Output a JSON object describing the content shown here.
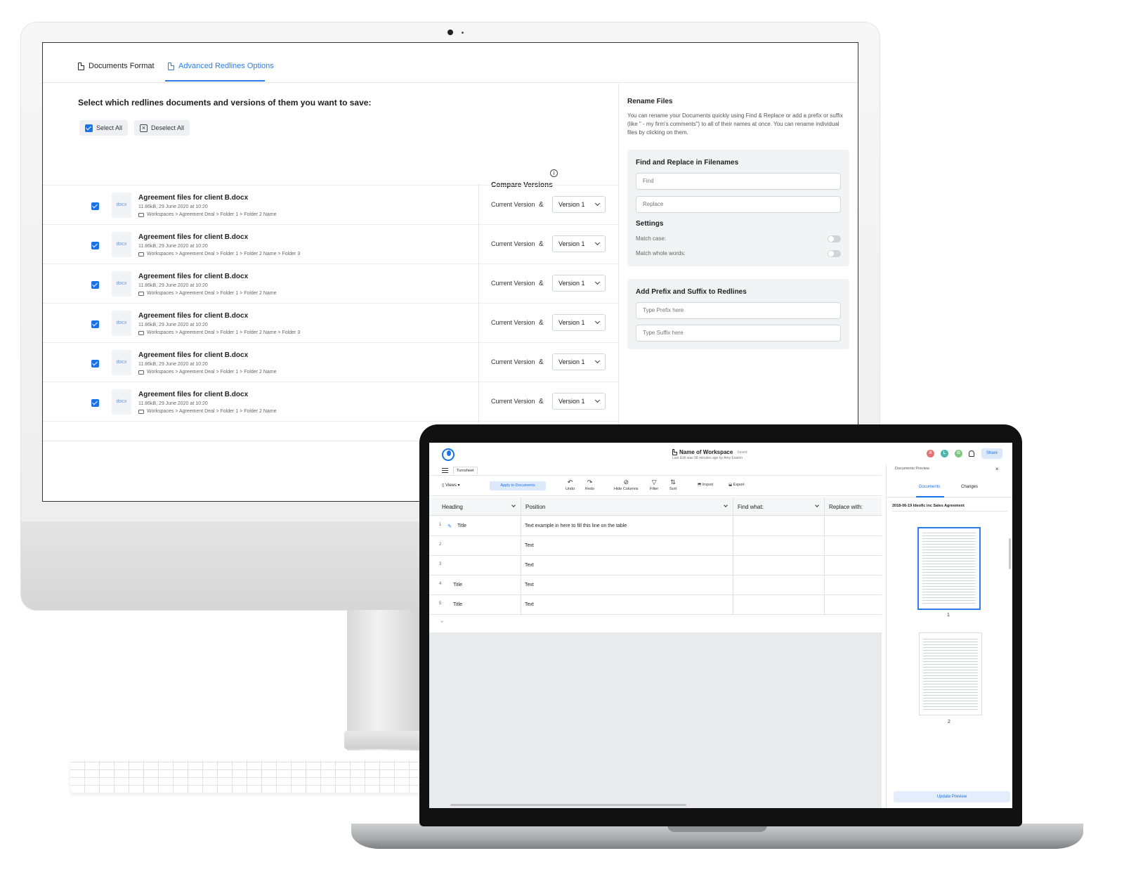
{
  "imac": {
    "tabs": [
      {
        "label": "Documents Format"
      },
      {
        "label": "Advanced Redlines Options"
      }
    ],
    "heading": "Select which redlines documents and versions of them you want to save:",
    "select_all": "Select All",
    "deselect_all": "Deselect All",
    "compare_versions": "Compare Versions",
    "files": [
      {
        "name": "Agreement files for client B.docx",
        "meta": "11.86kB, 29 June 2020 at 10:20",
        "path": "Workspaces > Agreement Deal > Folder 1 > Folder 2 Name",
        "current": "Current Version",
        "amp": "&",
        "version": "Version 1",
        "thumb": "docx"
      },
      {
        "name": "Agreement files for client B.docx",
        "meta": "11.86kB, 29 June 2020 at 10:20",
        "path": "Workspaces > Agreement Deal > Folder 1 > Folder 2 Name > Folder 3",
        "current": "Current Version",
        "amp": "&",
        "version": "Version 1",
        "thumb": "docx"
      },
      {
        "name": "Agreement files for client B.docx",
        "meta": "11.86kB, 29 June 2020 at 10:20",
        "path": "Workspaces > Agreement Deal > Folder 1 > Folder 2 Name",
        "current": "Current Version",
        "amp": "&",
        "version": "Version 1",
        "thumb": "docx"
      },
      {
        "name": "Agreement files for client B.docx",
        "meta": "11.86kB, 29 June 2020 at 10:20",
        "path": "Workspaces > Agreement Deal > Folder 1 > Folder 2 Name > Folder 3",
        "current": "Current Version",
        "amp": "&",
        "version": "Version 1",
        "thumb": "docx"
      },
      {
        "name": "Agreement files for client B.docx",
        "meta": "11.86kB, 29 June 2020 at 10:20",
        "path": "Workspaces > Agreement Deal > Folder 1 > Folder 2 Name",
        "current": "Current Version",
        "amp": "&",
        "version": "Version 1",
        "thumb": "docx"
      },
      {
        "name": "Agreement files for client B.docx",
        "meta": "11.86kB, 29 June 2020 at 10:20",
        "path": "Workspaces > Agreement Deal > Folder 1 > Folder 2 Name",
        "current": "Current Version",
        "amp": "&",
        "version": "Version 1",
        "thumb": "docx"
      }
    ],
    "rename": {
      "title": "Rename Files",
      "description": "You can rename your Documents quickly using Find & Replace or add a prefix or suffix (like \" - my firm's comments\") to all of their names at once. You can rename individual files by clicking on them.",
      "find_replace_title": "Find and Replace in Filenames",
      "find_placeholder": "Find",
      "replace_placeholder": "Replace",
      "settings_title": "Settings",
      "match_case": "Match case:",
      "match_whole": "Match whole words:",
      "prefix_title": "Add Prefix and Suffix to Redlines",
      "prefix_placeholder": "Type Prefix here",
      "suffix_placeholder": "Type Suffix here"
    }
  },
  "laptop": {
    "workspace_name": "Name of Workspace",
    "saved": "Saved",
    "last_edit": "Last Edit was 58 minutes ago by Amy Easton",
    "avatars": [
      {
        "letter": "A",
        "color": "#e57373"
      },
      {
        "letter": "L",
        "color": "#4db6ac"
      },
      {
        "letter": "G",
        "color": "#81c784"
      }
    ],
    "share": "Share",
    "sheet_tab": "Turnsheet",
    "toolbar": {
      "views": "Views",
      "apply": "Apply to Documents",
      "undo": "Undo",
      "redo": "Redo",
      "hide_columns": "Hide Columns",
      "filter": "Filter",
      "sort": "Sort",
      "import": "Import",
      "export": "Export"
    },
    "columns": [
      "Heading",
      "Position",
      "Find what:",
      "Replace with:"
    ],
    "rows": [
      {
        "num": "1",
        "heading": "Title",
        "position": "Text example in here to fill this line on the table"
      },
      {
        "num": "2",
        "heading": "",
        "position": "Text"
      },
      {
        "num": "3",
        "heading": "",
        "position": "Text"
      },
      {
        "num": "4",
        "heading": "Title",
        "position": "Text"
      },
      {
        "num": "5",
        "heading": "Title",
        "position": "Text"
      }
    ],
    "add_row": "+",
    "preview": {
      "title": "Documents Preview",
      "tab_documents": "Documents",
      "tab_changes": "Changes",
      "doc_name": "2018-06-19 Ideofic inc Sales Agreement",
      "pages": [
        "1",
        "2"
      ],
      "update": "Update Preview"
    }
  }
}
